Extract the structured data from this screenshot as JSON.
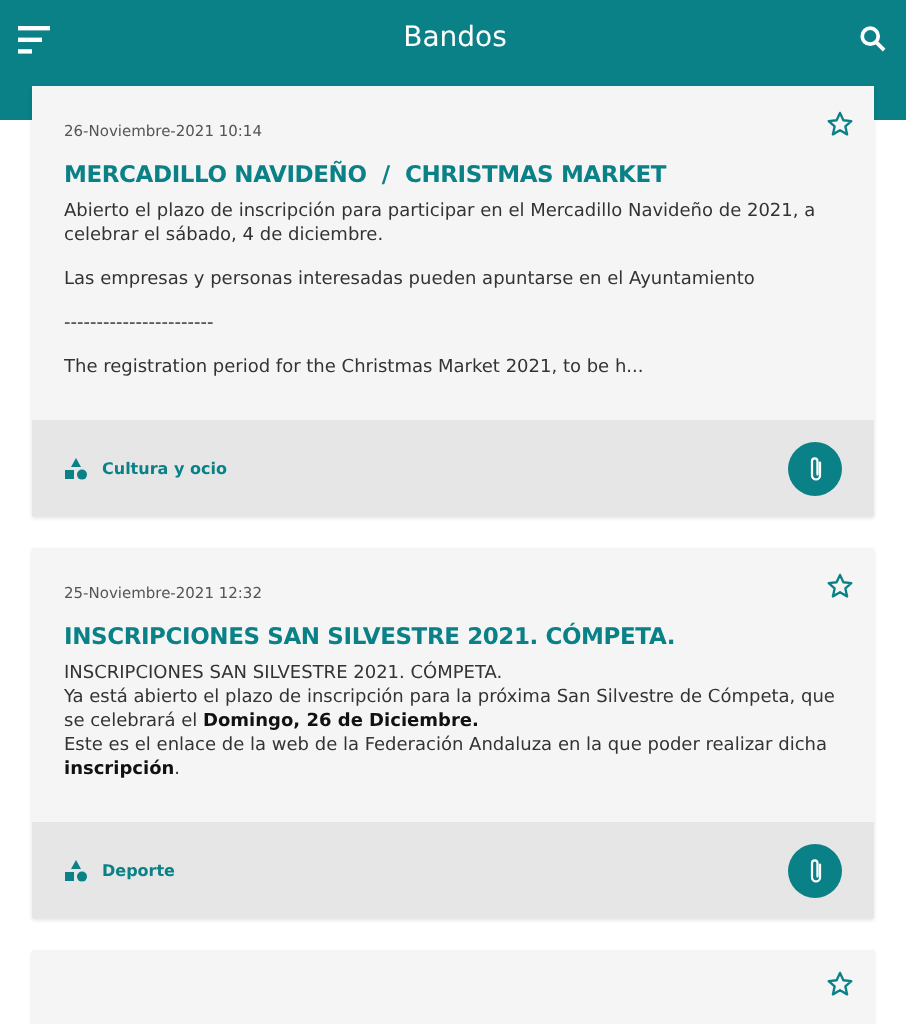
{
  "app_bar": {
    "title": "Bandos"
  },
  "cards": [
    {
      "date": "26-Noviembre-2021 10:14",
      "title": "MERCADILLO NAVIDEÑO  /  CHRISTMAS MARKET",
      "favorite": false,
      "paragraphs": [
        [
          "Abierto el plazo de inscripción para participar en el Mercadillo Navideño de 2021, a celebrar el sábado, 4 de diciembre."
        ],
        [
          "Las empresas y personas interesadas pueden apuntarse en el Ayuntamiento"
        ],
        [
          "-----------------------"
        ],
        [
          "The registration period for the Christmas Market 2021, to be h..."
        ]
      ],
      "category": "Cultura y ocio"
    },
    {
      "date": "25-Noviembre-2021 12:32",
      "title": "INSCRIPCIONES SAN SILVESTRE 2021. CÓMPETA.",
      "favorite": false,
      "paragraphs": [
        [
          "INSCRIPCIONES SAN SILVESTRE 2021. CÓMPETA.",
          "Ya está abierto el plazo de inscripción para la próxima San Silvestre de Cómpeta, que se celebrará el **Domingo, 26 de Diciembre.**",
          "Este es el enlace de la web de la Federación Andaluza en la que poder realizar dicha **inscripción**."
        ]
      ],
      "category": "Deporte"
    },
    {
      "favorite": false
    }
  ]
}
